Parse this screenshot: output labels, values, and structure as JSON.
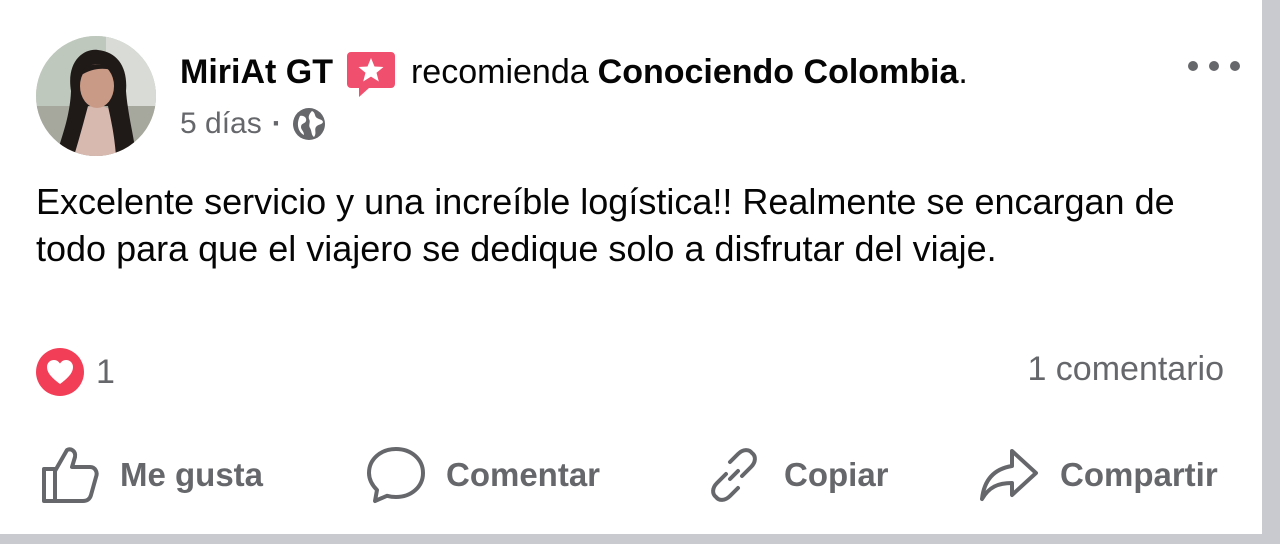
{
  "post": {
    "author": "MiriAt GT",
    "verb": "recomienda",
    "page": "Conociendo Colombia",
    "period": ".",
    "time": "5 días",
    "separator": "·",
    "privacy_icon": "globe-icon",
    "recommend_icon": "star-speech-bubble-icon",
    "text": "Excelente servicio y una increíble logística!! Realmente se encargan de todo para que el viajero se dedique solo a disfrutar del viaje."
  },
  "stats": {
    "reaction_icon": "heart-reaction-icon",
    "reaction_count": "1",
    "comments": "1 comentario"
  },
  "actions": [
    {
      "label": "Me gusta",
      "icon": "thumbs-up-icon"
    },
    {
      "label": "Comentar",
      "icon": "comment-bubble-icon"
    },
    {
      "label": "Copiar",
      "icon": "link-icon"
    },
    {
      "label": "Compartir",
      "icon": "share-arrow-icon"
    }
  ],
  "colors": {
    "text": "#050505",
    "secondary": "#65676b",
    "recommend_badge": "#f0506e",
    "love": "#f33e58"
  }
}
